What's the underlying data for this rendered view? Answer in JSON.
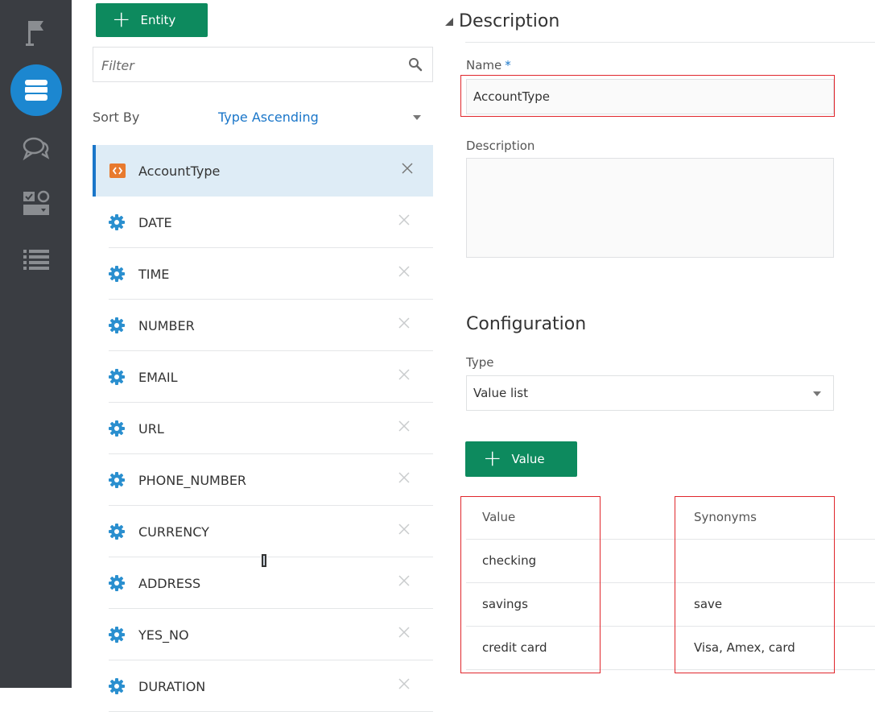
{
  "rail": {
    "items": [
      {
        "icon": "flag-icon"
      },
      {
        "icon": "database-icon",
        "active": true
      },
      {
        "icon": "chat-bubbles-icon"
      },
      {
        "icon": "components-icon"
      },
      {
        "icon": "list-icon"
      }
    ]
  },
  "entities_panel": {
    "add_button_label": "Entity",
    "filter_placeholder": "Filter",
    "sort_label": "Sort By",
    "sort_value": "Type Ascending",
    "items": [
      {
        "label": "AccountType",
        "icon": "custom-entity-icon",
        "selected": true
      },
      {
        "label": "DATE",
        "icon": "system-entity-gear-icon"
      },
      {
        "label": "TIME",
        "icon": "system-entity-gear-icon"
      },
      {
        "label": "NUMBER",
        "icon": "system-entity-gear-icon"
      },
      {
        "label": "EMAIL",
        "icon": "system-entity-gear-icon"
      },
      {
        "label": "URL",
        "icon": "system-entity-gear-icon"
      },
      {
        "label": "PHONE_NUMBER",
        "icon": "system-entity-gear-icon"
      },
      {
        "label": "CURRENCY",
        "icon": "system-entity-gear-icon"
      },
      {
        "label": "ADDRESS",
        "icon": "system-entity-gear-icon"
      },
      {
        "label": "YES_NO",
        "icon": "system-entity-gear-icon"
      },
      {
        "label": "DURATION",
        "icon": "system-entity-gear-icon"
      }
    ]
  },
  "detail": {
    "description_header": "Description",
    "name_label": "Name",
    "name_required_mark": "*",
    "name_value": "AccountType",
    "description_label": "Description",
    "description_value": "",
    "configuration_header": "Configuration",
    "type_label": "Type",
    "type_value": "Value list",
    "add_value_label": "Value",
    "table": {
      "headers": [
        "Value",
        "Synonyms"
      ],
      "rows": [
        [
          "checking",
          ""
        ],
        [
          "savings",
          "save"
        ],
        [
          "credit card",
          "Visa, Amex, card"
        ]
      ]
    }
  },
  "colors": {
    "rail_bg": "#3a3d42",
    "rail_active": "#1c87d0",
    "primary_button": "#0d8a5e",
    "link_blue": "#1a76c9",
    "selected_row_bg": "#deecf6",
    "highlight_red": "#e0262c",
    "gear_icon": "#2a8fcf",
    "custom_entity_icon": "#e87a2e"
  }
}
